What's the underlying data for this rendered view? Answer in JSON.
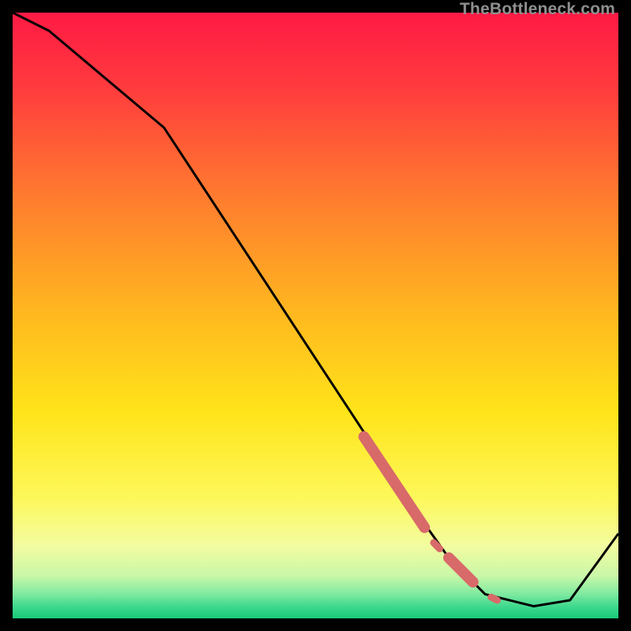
{
  "watermark": "TheBottleneck.com",
  "chart_data": {
    "type": "line",
    "title": "",
    "xlabel": "",
    "ylabel": "",
    "xlim": [
      0,
      100
    ],
    "ylim": [
      0,
      100
    ],
    "background": "vertical-gradient red→orange→yellow→green",
    "series": [
      {
        "name": "bottleneck-curve",
        "color": "#000000",
        "x": [
          0,
          6,
          25,
          67,
          72,
          78,
          86,
          92,
          100
        ],
        "values": [
          100,
          97,
          81,
          17,
          10,
          4,
          2,
          3,
          14
        ]
      }
    ],
    "highlight": {
      "name": "highlighted-range",
      "color": "#d86a6a",
      "segments": [
        {
          "x_start": 58,
          "y_start": 30,
          "x_end": 68,
          "y_end": 15,
          "thick": true
        },
        {
          "x_start": 69.5,
          "y_start": 12.5,
          "x_end": 70.5,
          "y_end": 11.5,
          "thick": false
        },
        {
          "x_start": 72,
          "y_start": 10,
          "x_end": 76,
          "y_end": 6,
          "thick": true
        },
        {
          "x_start": 79,
          "y_start": 3.5,
          "x_end": 80,
          "y_end": 3,
          "thick": false
        }
      ]
    }
  }
}
